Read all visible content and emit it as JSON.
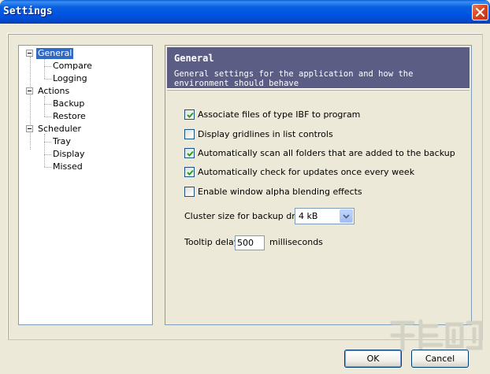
{
  "window": {
    "title": "Settings",
    "close_icon": "close-x-icon"
  },
  "tree": {
    "items": [
      {
        "label": "General",
        "level": 0,
        "expandable": true,
        "selected": true
      },
      {
        "label": "Compare",
        "level": 1
      },
      {
        "label": "Logging",
        "level": 1
      },
      {
        "label": "Actions",
        "level": 0,
        "expandable": true
      },
      {
        "label": "Backup",
        "level": 1
      },
      {
        "label": "Restore",
        "level": 1
      },
      {
        "label": "Scheduler",
        "level": 0,
        "expandable": true
      },
      {
        "label": "Tray",
        "level": 1
      },
      {
        "label": "Display",
        "level": 1
      },
      {
        "label": "Missed",
        "level": 1
      }
    ]
  },
  "header": {
    "title": "General",
    "description": "General settings for the application and how the environment should behave"
  },
  "options": [
    {
      "label": "Associate files of type IBF to program",
      "checked": true
    },
    {
      "label": "Display gridlines in list controls",
      "checked": false
    },
    {
      "label": "Automatically scan all folders that are added to the backup",
      "checked": true
    },
    {
      "label": "Automatically check for updates once every week",
      "checked": true
    },
    {
      "label": "Enable window alpha blending effects",
      "checked": false
    }
  ],
  "cluster": {
    "label": "Cluster size for backup drive",
    "value": "4 kB"
  },
  "tooltip": {
    "label": "Tooltip delay",
    "value": "500",
    "unit": "milliseconds"
  },
  "buttons": {
    "ok": "OK",
    "cancel": "Cancel"
  },
  "colors": {
    "header_bg": "#5c5d85",
    "selection": "#316ac5",
    "titlebar": "#0054e3"
  }
}
